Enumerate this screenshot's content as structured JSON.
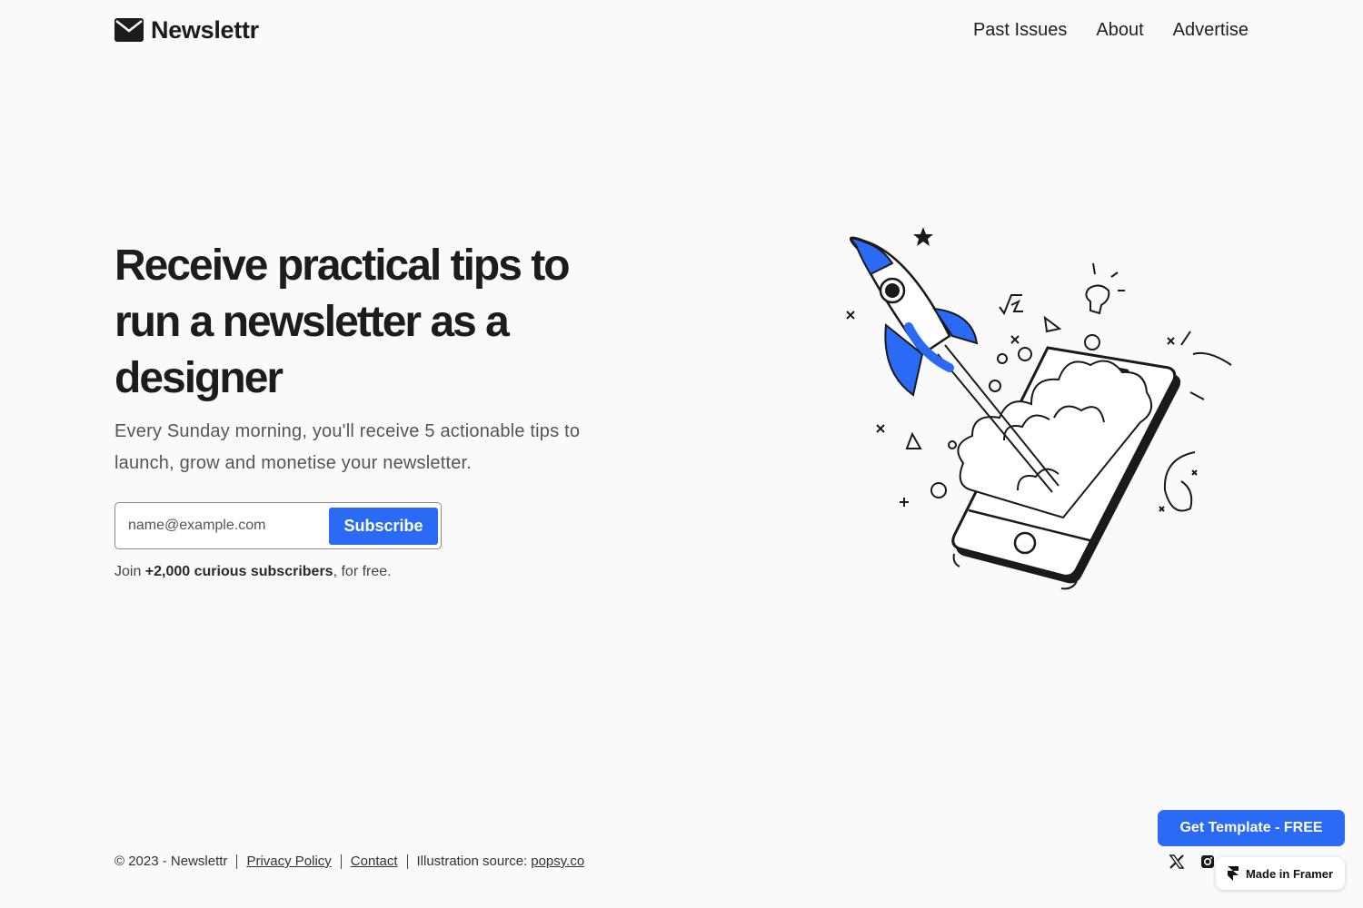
{
  "header": {
    "logo_text": "Newslettr",
    "nav": [
      {
        "label": "Past Issues"
      },
      {
        "label": "About"
      },
      {
        "label": "Advertise"
      }
    ]
  },
  "hero": {
    "title": "Receive practical tips to run a newsletter as a designer",
    "subtitle": "Every Sunday morning, you'll receive 5 actionable tips to launch, grow and monetise your newsletter.",
    "email_placeholder": "name@example.com",
    "subscribe_label": "Subscribe",
    "join_prefix": "Join ",
    "join_bold": "+2,000 curious subscribers",
    "join_suffix": ", for free."
  },
  "footer": {
    "copyright": "© 2023 - Newslettr",
    "privacy": "Privacy Policy",
    "contact": "Contact",
    "illustration_prefix": "Illustration source: ",
    "illustration_link": "popsy.co",
    "socials": [
      "x-icon",
      "instagram-icon"
    ]
  },
  "floating": {
    "get_template": "Get Template - FREE",
    "made_in_framer": "Made in Framer"
  },
  "colors": {
    "accent": "#2b6af5",
    "background": "#fafafa"
  }
}
